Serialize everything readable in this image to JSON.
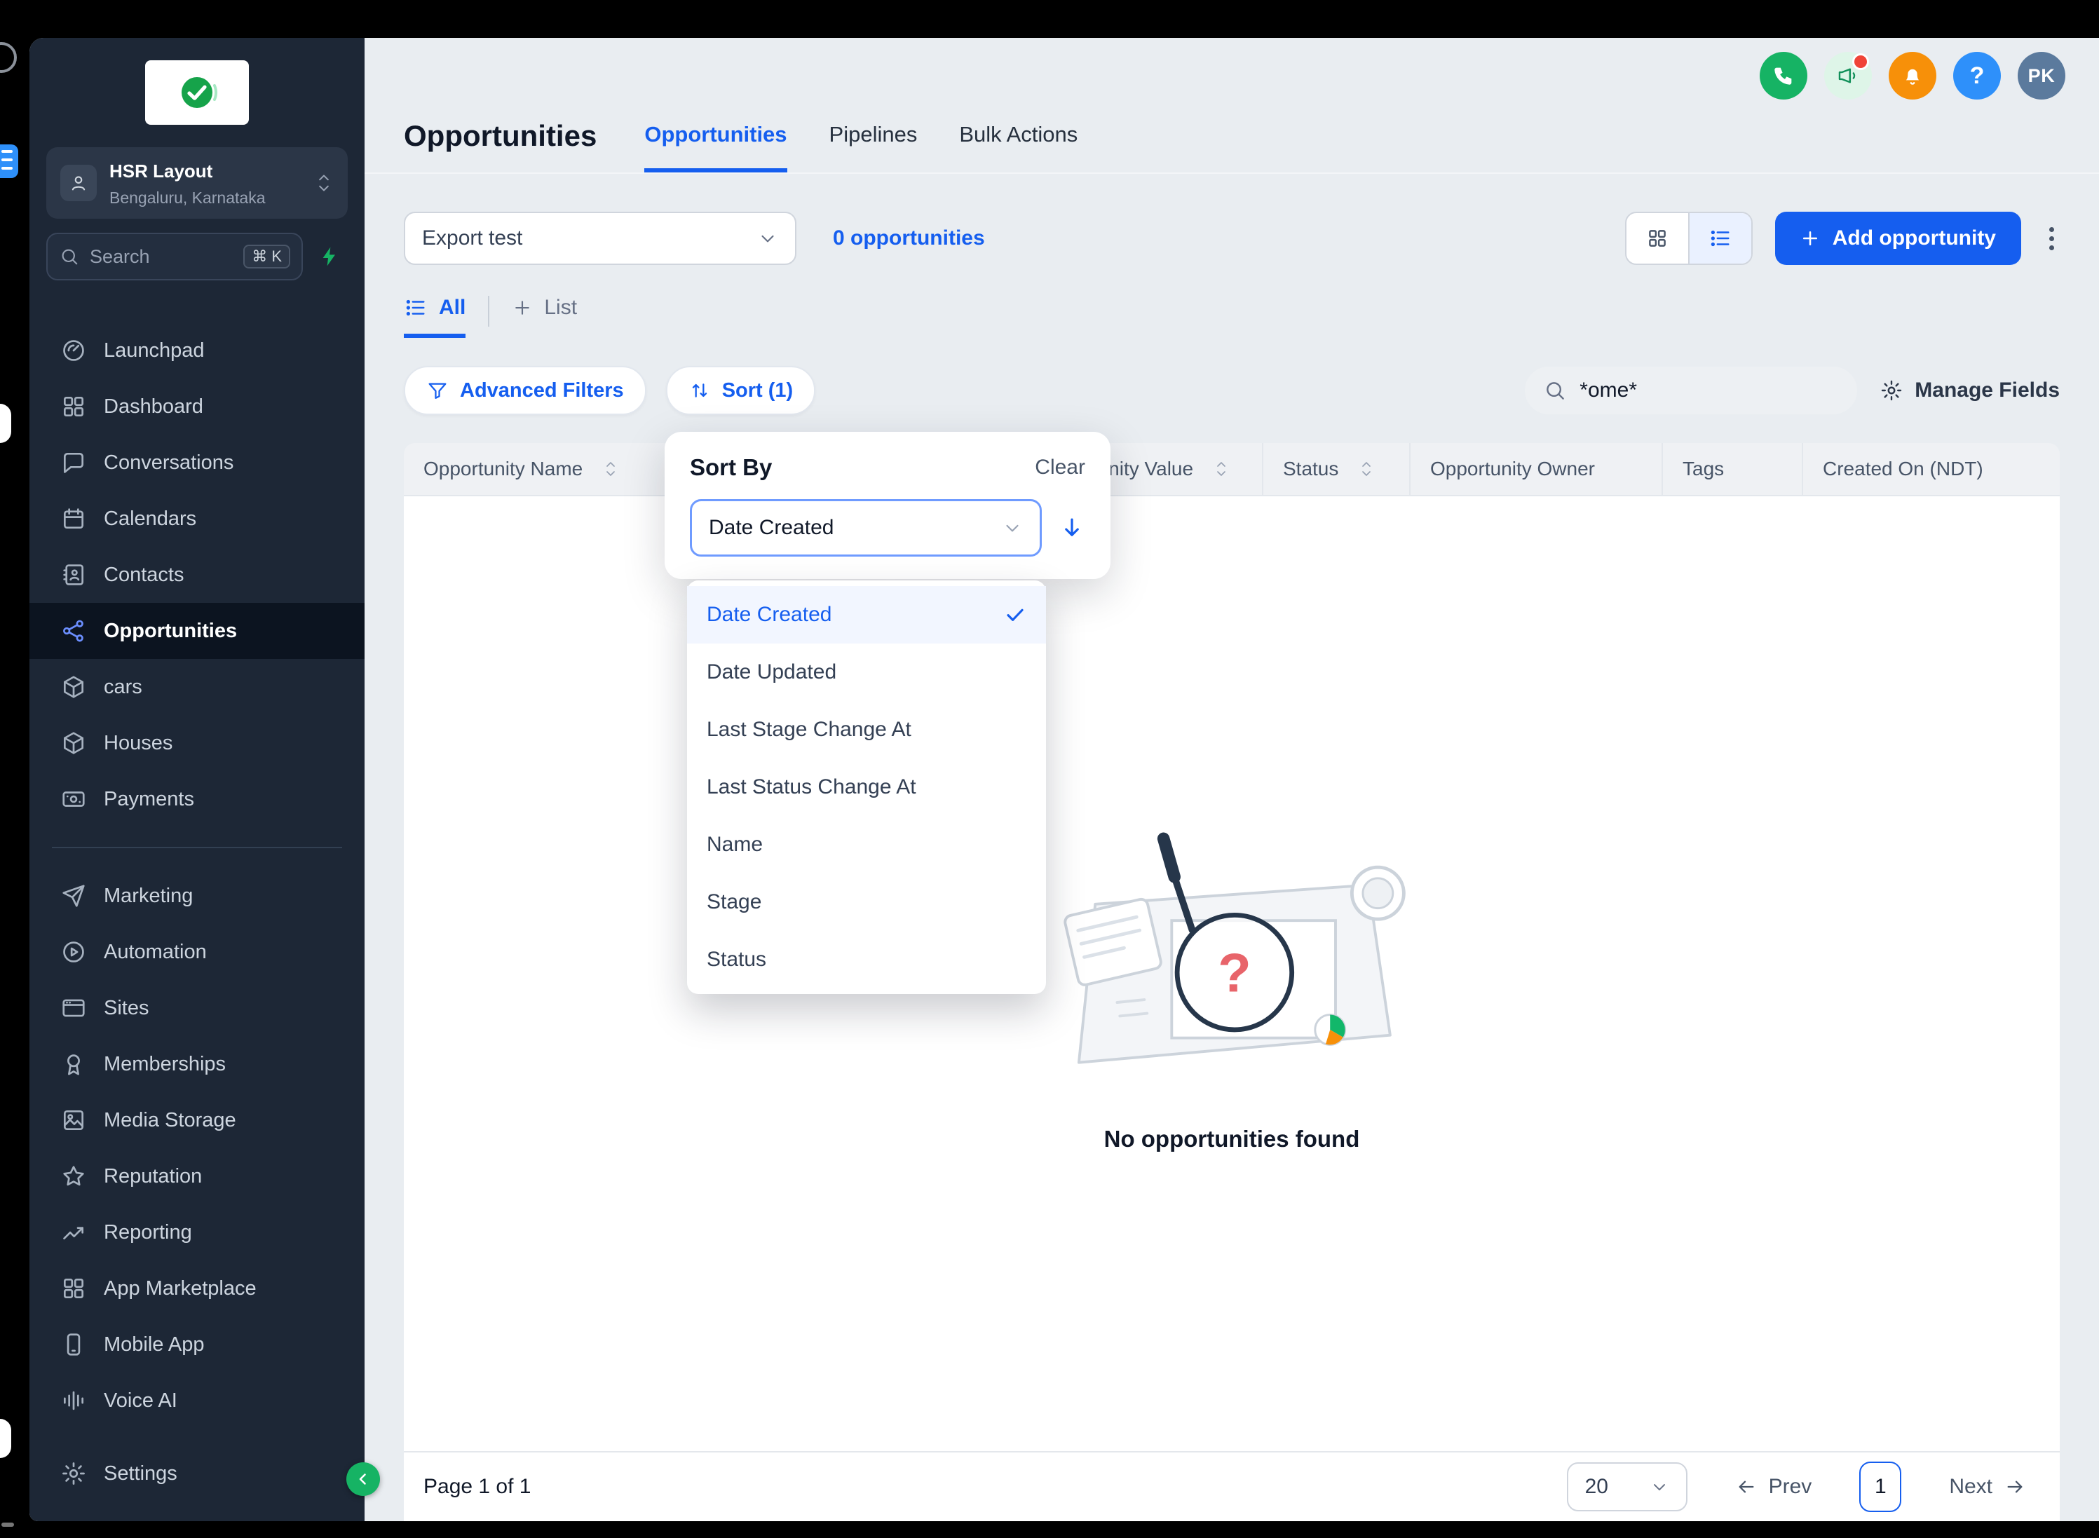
{
  "colors": {
    "accent_blue": "#155eef",
    "sidebar_bg": "#1d2736",
    "page_bg": "#e9edf1",
    "green": "#16b364",
    "orange": "#f79009",
    "notification_red": "#f04438"
  },
  "sidebar": {
    "location": {
      "name": "HSR Layout",
      "area": "Bengaluru, Karnataka"
    },
    "search": {
      "placeholder": "Search",
      "shortcut": "⌘ K"
    },
    "items": [
      {
        "label": "Launchpad"
      },
      {
        "label": "Dashboard"
      },
      {
        "label": "Conversations"
      },
      {
        "label": "Calendars"
      },
      {
        "label": "Contacts"
      },
      {
        "label": "Opportunities",
        "active": true
      },
      {
        "label": "cars"
      },
      {
        "label": "Houses"
      },
      {
        "label": "Payments"
      },
      {
        "label": "Marketing"
      },
      {
        "label": "Automation"
      },
      {
        "label": "Sites"
      },
      {
        "label": "Memberships"
      },
      {
        "label": "Media Storage"
      },
      {
        "label": "Reputation"
      },
      {
        "label": "Reporting"
      },
      {
        "label": "App Marketplace"
      },
      {
        "label": "Mobile App"
      },
      {
        "label": "Voice AI"
      }
    ],
    "settings_label": "Settings"
  },
  "header": {
    "title": "Opportunities",
    "tabs": [
      {
        "label": "Opportunities",
        "active": true
      },
      {
        "label": "Pipelines",
        "active": false
      },
      {
        "label": "Bulk Actions",
        "active": false
      }
    ],
    "avatar_initials": "PK"
  },
  "toolbar": {
    "saved_view": "Export test",
    "count_label": "0 opportunities",
    "add_label": "Add opportunity"
  },
  "view_tabs": {
    "all_label": "All",
    "new_list_label": "List"
  },
  "filter_bar": {
    "advanced_filters": "Advanced Filters",
    "sort": "Sort (1)",
    "search_value": "*ome*",
    "manage_fields": "Manage Fields"
  },
  "table": {
    "columns": [
      {
        "label": "Opportunity Name",
        "sortable": true
      },
      {
        "label": "Opportunity Value",
        "sortable": true
      },
      {
        "label": "Status",
        "sortable": true
      },
      {
        "label": "Opportunity Owner",
        "sortable": false
      },
      {
        "label": "Tags",
        "sortable": false
      },
      {
        "label": "Created On (NDT)",
        "sortable": false
      }
    ],
    "empty_text": "No opportunities found"
  },
  "sort_popup": {
    "title": "Sort By",
    "clear_label": "Clear",
    "selected_field": "Date Created",
    "selected_index": 0,
    "options": [
      "Date Created",
      "Date Updated",
      "Last Stage Change At",
      "Last Status Change At",
      "Name",
      "Stage",
      "Status"
    ]
  },
  "pagination": {
    "page_info": "Page 1 of 1",
    "page_size": "20",
    "prev_label": "Prev",
    "page_number": "1",
    "next_label": "Next"
  }
}
